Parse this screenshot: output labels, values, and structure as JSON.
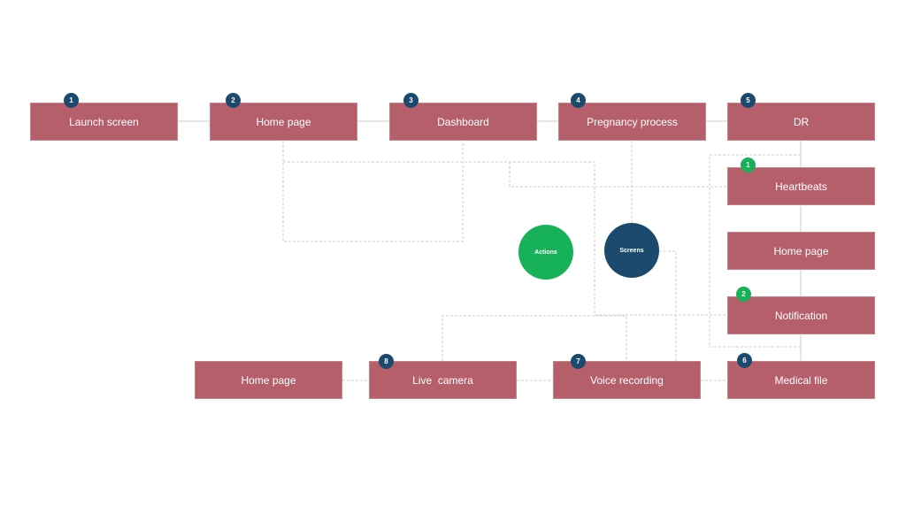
{
  "colors": {
    "node": "#b55f6b",
    "screen_badge": "#1b4a6e",
    "action_badge": "#17b15a",
    "connector": "#cccccc"
  },
  "nodes": {
    "launch": {
      "label": "Launch screen",
      "badge": "1"
    },
    "home": {
      "label": "Home page",
      "badge": "2"
    },
    "dashboard": {
      "label": "Dashboard",
      "badge": "3"
    },
    "pregnancy": {
      "label": "Pregnancy process",
      "badge": "4"
    },
    "dr": {
      "label": "DR",
      "badge": "5"
    },
    "heartbeats": {
      "label": "Heartbeats",
      "badge": "1"
    },
    "home2": {
      "label": "Home page"
    },
    "notification": {
      "label": "Notification",
      "badge": "2"
    },
    "medical": {
      "label": "Medical file",
      "badge": "6"
    },
    "voice": {
      "label": "Voice recording",
      "badge": "7"
    },
    "live": {
      "label": "Live  camera",
      "badge": "8"
    },
    "home3": {
      "label": "Home page"
    }
  },
  "legend": {
    "actions": "Actions",
    "screens": "Screens"
  }
}
